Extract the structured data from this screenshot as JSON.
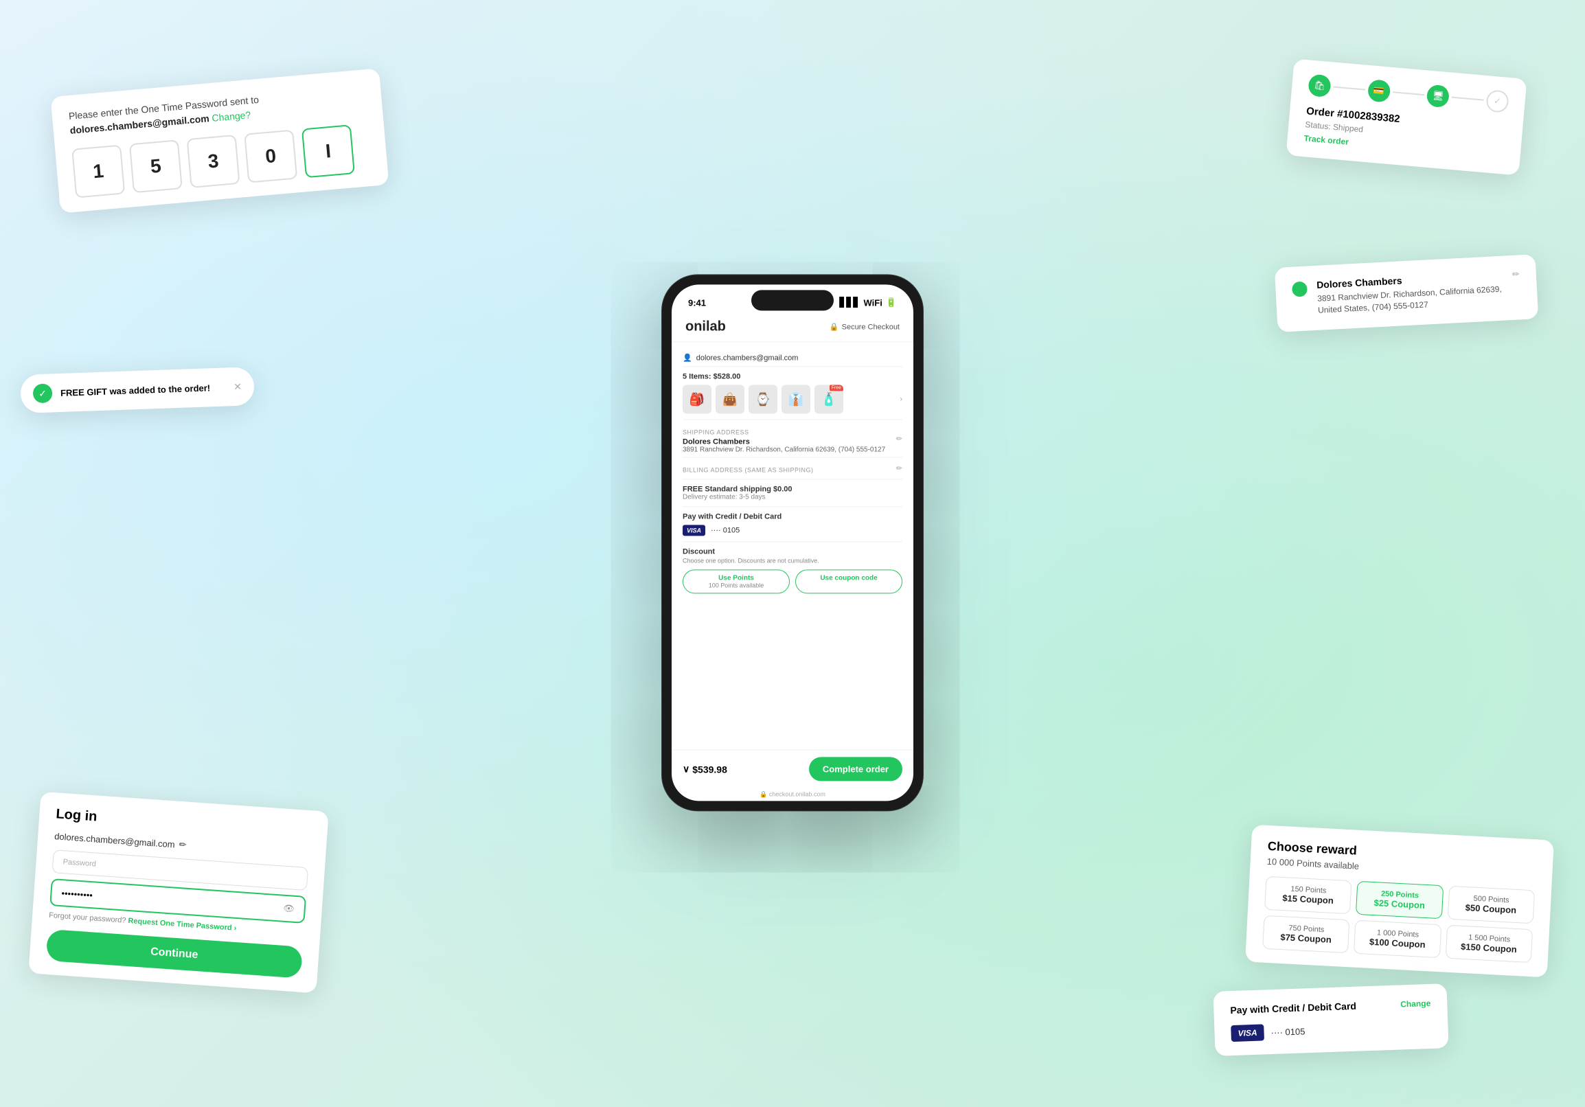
{
  "app": {
    "logo": "onilab",
    "secure_checkout": "Secure Checkout",
    "url": "checkout.onilab.com"
  },
  "phone": {
    "status_time": "9:41",
    "email": "dolores.chambers@gmail.com",
    "items_label": "5 Items: $528.00",
    "shipping_address_label": "SHIPPING ADDRESS",
    "shipping_name": "Dolores Chambers",
    "shipping_address": "3891 Ranchview Dr. Richardson, California 62639, (704) 555-0127",
    "billing_address_label": "BILLING ADDRESS (SAME AS SHIPPING)",
    "shipping_type": "FREE Standard shipping",
    "shipping_price": "$0.00",
    "delivery": "Delivery estimate: 3-5 days",
    "payment_title": "Pay with Credit / Debit Card",
    "visa_number": "···· 0105",
    "discount_title": "Discount",
    "discount_sub": "Choose one option. Discounts are not cumulative.",
    "use_points_label": "Use Points",
    "points_available": "100 Points available",
    "use_coupon_label": "Use coupon code",
    "total_price": "$539.98",
    "complete_order": "Complete order",
    "footer_url": "checkout.onilab.com"
  },
  "otp_card": {
    "message": "Please enter the One Time Password sent to",
    "email": "dolores.chambers@gmail.com",
    "change_label": "Change?",
    "digits": [
      "1",
      "5",
      "3",
      "0",
      "I"
    ]
  },
  "login_card": {
    "title": "Log in",
    "email": "dolores.chambers@gmail.com",
    "edit_icon": "✏",
    "password_placeholder": "Password",
    "password_value": "••••••••••",
    "eye_icon": "👁",
    "forgot_label": "Forgot your password?",
    "otp_label": "Request One Time Password",
    "continue_label": "Continue"
  },
  "gift_card": {
    "message": "FREE GIFT was added to the order!",
    "close": "✕"
  },
  "order_card": {
    "order_number": "Order #1002839382",
    "status_label": "Status:",
    "status_value": "Shipped",
    "track_label": "Track order",
    "steps": [
      "bag",
      "card",
      "monitor",
      "check"
    ]
  },
  "address_card": {
    "name": "Dolores Chambers",
    "address": "3891 Ranchview Dr. Richardson, California 62639, United States, (704) 555-0127"
  },
  "reward_card": {
    "title": "Choose reward",
    "points_available": "10 000 Points available",
    "options": [
      {
        "points": "150 Points",
        "coupon": "$15 Coupon",
        "selected": false
      },
      {
        "points": "250 Points",
        "coupon": "$25 Coupon",
        "selected": true
      },
      {
        "points": "500 Points",
        "coupon": "$50 Coupon",
        "selected": false
      },
      {
        "points": "750 Points",
        "coupon": "$75 Coupon",
        "selected": false
      },
      {
        "points": "1 000 Points",
        "coupon": "$100 Coupon",
        "selected": false
      },
      {
        "points": "1 500 Points",
        "coupon": "$150 Coupon",
        "selected": false
      }
    ]
  },
  "payment_card": {
    "title": "Pay with Credit / Debit Card",
    "change_label": "Change",
    "visa_number": "···· 0105"
  }
}
